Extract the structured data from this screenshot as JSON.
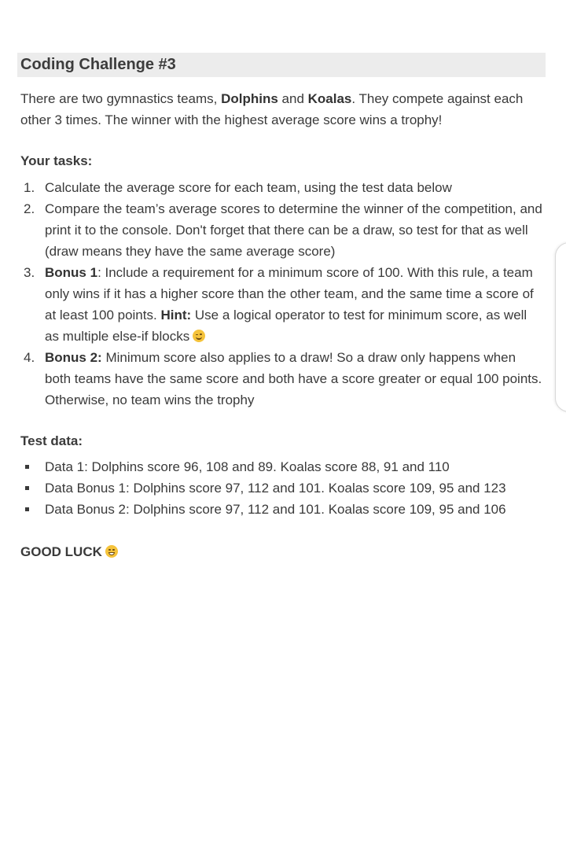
{
  "title": "Coding Challenge #3",
  "intro": {
    "p1": "There are two gymnastics teams, ",
    "team1": "Dolphins",
    "p2": " and ",
    "team2": "Koalas",
    "p3": ". They compete against each other 3 times. The winner with the highest average score wins a trophy!"
  },
  "tasks_heading": "Your tasks:",
  "tasks": [
    {
      "num": "1.",
      "text": "Calculate the average score for each team, using the test data below"
    },
    {
      "num": "2.",
      "text": "Compare the team’s average scores to determine the winner of the competition, and print it to the console. Don't forget that there can be a draw, so test for that as well (draw means they have the same average score)"
    },
    {
      "num": "3.",
      "bold_lead": "Bonus 1",
      "text_a": ": Include a requirement for a minimum score of 100. With this rule, a team only wins if it has a higher score than the other team, and the same time a score of at least 100 points. ",
      "hint_label": "Hint:",
      "text_b": " Use a logical operator to test for minimum score, as well as multiple else-if blocks",
      "emoji": "wink-emoji"
    },
    {
      "num": "4.",
      "bold_lead": "Bonus 2:",
      "text_a": " Minimum score also applies to a draw! So a draw only happens when both teams have the same score and both have a score greater or equal 100 points. Otherwise, no team wins the trophy"
    }
  ],
  "test_heading": "Test data:",
  "test_data": [
    "Data 1: Dolphins score 96, 108 and 89. Koalas score 88, 91 and 110",
    "Data Bonus 1: Dolphins score 97, 112 and 101. Koalas score 109, 95 and 123",
    "Data Bonus 2: Dolphins score 97, 112 and 101. Koalas score 109, 95 and 106"
  ],
  "good_luck": "GOOD LUCK",
  "good_luck_emoji": "grin-emoji",
  "colors": {
    "title_bg": "#ececec",
    "text": "#3a3a3a",
    "emoji": "#f5c33b"
  }
}
